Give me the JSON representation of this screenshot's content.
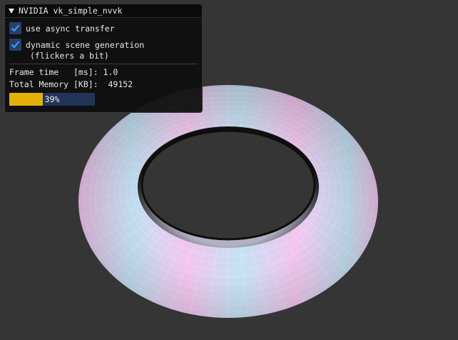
{
  "window": {
    "title": "NVIDIA vk_simple_nvvk"
  },
  "options": [
    {
      "label": "use async transfer",
      "checked": true
    },
    {
      "label": "dynamic scene generation",
      "checked": true
    }
  ],
  "options_note": "(flickers a bit)",
  "stats": {
    "frame_time": "Frame time   [ms]: 1.0",
    "total_memory": "Total Memory [KB]:  49152"
  },
  "progress": {
    "value": 0.39,
    "label": "39%",
    "fill_color": "#e3b00a",
    "track_color": "#223458"
  },
  "scene": {
    "background_color": "#353535",
    "object": "torus",
    "tint_colors": [
      "#f3c4ee",
      "#c3e2f4"
    ]
  }
}
